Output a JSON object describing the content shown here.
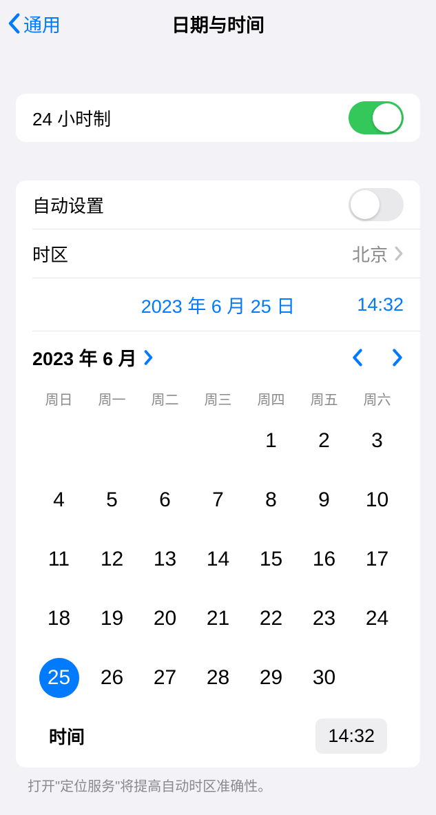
{
  "header": {
    "back_label": "通用",
    "title": "日期与时间"
  },
  "section1": {
    "twenty_four_hour_label": "24 小时制",
    "twenty_four_hour_on": true
  },
  "section2": {
    "auto_set_label": "自动设置",
    "auto_set_on": false,
    "timezone_label": "时区",
    "timezone_value": "北京",
    "selected_date": "2023 年 6 月 25 日",
    "selected_time": "14:32"
  },
  "calendar": {
    "month_label": "2023 年 6 月",
    "weekdays": [
      "周日",
      "周一",
      "周二",
      "周三",
      "周四",
      "周五",
      "周六"
    ],
    "leading_blanks": 4,
    "days_in_month": 30,
    "selected_day": 25,
    "time_label": "时间",
    "time_value": "14:32"
  },
  "footer": {
    "note": "打开\"定位服务\"将提高自动时区准确性。"
  }
}
